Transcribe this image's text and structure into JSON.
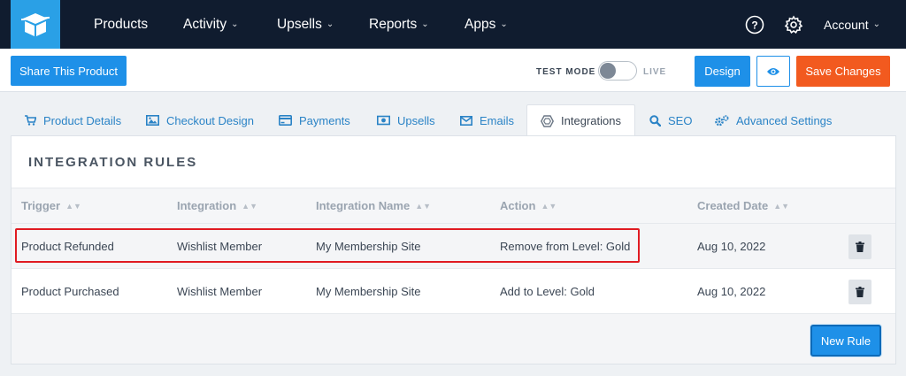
{
  "nav": {
    "items": [
      {
        "label": "Products",
        "has_menu": false
      },
      {
        "label": "Activity",
        "has_menu": true
      },
      {
        "label": "Upsells",
        "has_menu": true
      },
      {
        "label": "Reports",
        "has_menu": true
      },
      {
        "label": "Apps",
        "has_menu": true
      }
    ],
    "help_icon": "question-circle-icon",
    "settings_icon": "gear-icon",
    "account_label": "Account"
  },
  "toolbar": {
    "share_label": "Share This Product",
    "test_mode_label": "TEST MODE",
    "live_label": "LIVE",
    "design_label": "Design",
    "preview_icon": "eye-icon",
    "save_label": "Save Changes"
  },
  "tabs": [
    {
      "label": "Product Details",
      "icon": "cart-icon"
    },
    {
      "label": "Checkout Design",
      "icon": "image-icon"
    },
    {
      "label": "Payments",
      "icon": "credit-card-icon"
    },
    {
      "label": "Upsells",
      "icon": "money-icon"
    },
    {
      "label": "Emails",
      "icon": "envelope-icon"
    },
    {
      "label": "Integrations",
      "icon": "hexagon-icon",
      "active": true
    },
    {
      "label": "SEO",
      "icon": "search-icon"
    },
    {
      "label": "Advanced Settings",
      "icon": "gears-icon"
    }
  ],
  "panel": {
    "title": "INTEGRATION RULES",
    "columns": [
      "Trigger",
      "Integration",
      "Integration Name",
      "Action",
      "Created Date"
    ],
    "rows": [
      {
        "trigger": "Product Refunded",
        "integration": "Wishlist Member",
        "name": "My Membership Site",
        "action": "Remove from Level: Gold",
        "date": "Aug 10, 2022"
      },
      {
        "trigger": "Product Purchased",
        "integration": "Wishlist Member",
        "name": "My Membership Site",
        "action": "Add to Level: Gold",
        "date": "Aug 10, 2022"
      }
    ],
    "new_rule_label": "New Rule"
  },
  "colors": {
    "nav_bg": "#101c2f",
    "accent_blue": "#1e90e8",
    "save_orange": "#f25a1f",
    "highlight_red": "#e01b22"
  }
}
